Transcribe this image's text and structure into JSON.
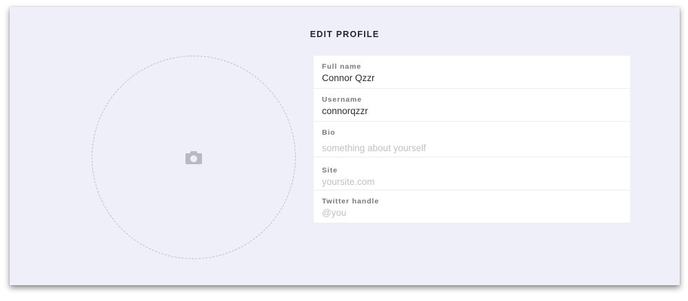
{
  "page": {
    "title": "EDIT PROFILE"
  },
  "avatar": {
    "icon": "camera-icon"
  },
  "form": {
    "fields": [
      {
        "label": "Full name",
        "value": "Connor Qzzr",
        "placeholder": ""
      },
      {
        "label": "Username",
        "value": "connorqzzr",
        "placeholder": ""
      },
      {
        "label": "Bio",
        "value": "",
        "placeholder": "something about yourself"
      },
      {
        "label": "Site",
        "value": "",
        "placeholder": "yoursite.com"
      },
      {
        "label": "Twitter handle",
        "value": "",
        "placeholder": "@you"
      }
    ]
  },
  "colors": {
    "background": "#efeff9",
    "panel": "#ffffff",
    "icon": "#b9b9c2"
  }
}
